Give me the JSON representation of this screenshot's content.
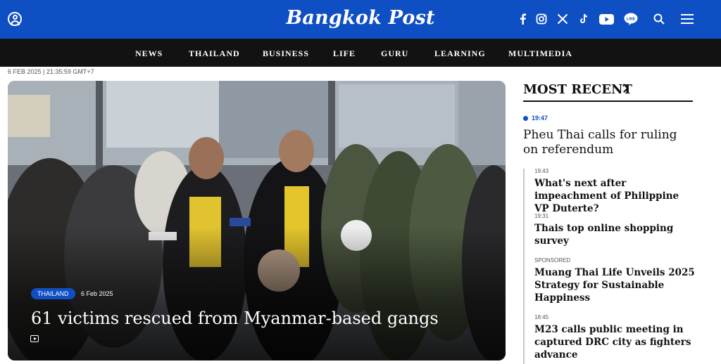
{
  "header": {
    "logo": "Bangkok Post",
    "icons": [
      "user-icon",
      "facebook-icon",
      "instagram-icon",
      "x-icon",
      "tiktok-icon",
      "youtube-icon",
      "line-icon",
      "search-icon",
      "menu-icon"
    ],
    "brand_color": "#0f4fc4"
  },
  "nav": {
    "items": [
      "NEWS",
      "THAILAND",
      "BUSINESS",
      "LIFE",
      "GURU",
      "LEARNING",
      "MULTIMEDIA"
    ]
  },
  "timestamp": "6 FEB 2025 | 21:35:59 GMT+7",
  "hero": {
    "category": "THAILAND",
    "date": "6 Feb 2025",
    "title": "61 victims rescued from Myanmar-based gangs",
    "media_icon": "video-icon"
  },
  "sidebar": {
    "heading": "MOST RECENT",
    "lead": {
      "time": "19:47",
      "title": "Pheu Thai calls for ruling on referendum"
    },
    "items": [
      {
        "time": "19:43",
        "title": "What's next after impeachment of Philippine VP Duterte?"
      },
      {
        "time": "19:31",
        "title": "Thais top online shopping survey"
      },
      {
        "time": "SPONSORED",
        "title": "Muang Thai Life Unveils 2025 Strategy for Sustainable Happiness"
      },
      {
        "time": "18:45",
        "title": "M23 calls public meeting in captured DRC city as fighters advance"
      }
    ]
  }
}
